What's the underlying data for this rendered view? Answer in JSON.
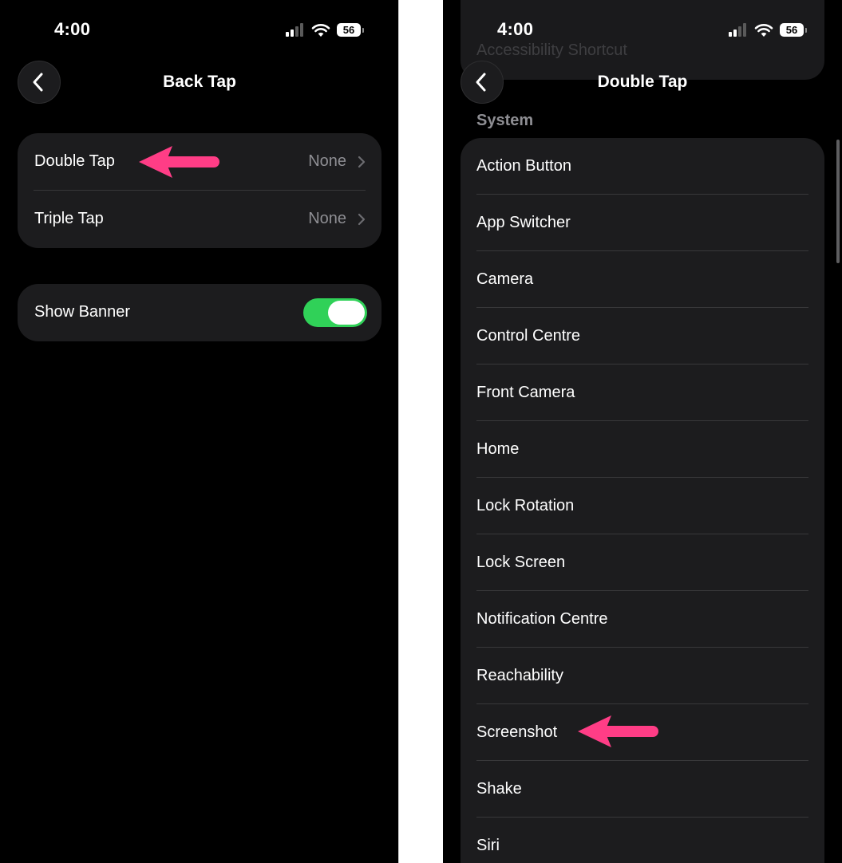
{
  "left_screen": {
    "status": {
      "time": "4:00",
      "battery": "56"
    },
    "nav": {
      "title": "Back Tap"
    },
    "tap_group": [
      {
        "label": "Double Tap",
        "value": "None"
      },
      {
        "label": "Triple Tap",
        "value": "None"
      }
    ],
    "banner": {
      "label": "Show Banner",
      "enabled": true
    }
  },
  "right_screen": {
    "status": {
      "time": "4:00",
      "battery": "56"
    },
    "nav": {
      "title": "Double Tap"
    },
    "ghost_item": "Accessibility Shortcut",
    "section_header": "System",
    "items": [
      "Action Button",
      "App Switcher",
      "Camera",
      "Control Centre",
      "Front Camera",
      "Home",
      "Lock Rotation",
      "Lock Screen",
      "Notification Centre",
      "Reachability",
      "Screenshot",
      "Shake",
      "Siri"
    ]
  },
  "colors": {
    "background": "#000000",
    "cell": "#1c1c1e",
    "separator": "#38383a",
    "secondary_text": "#8e8e93",
    "toggle_on": "#30d158",
    "annotation_arrow": "#ff3d86"
  }
}
